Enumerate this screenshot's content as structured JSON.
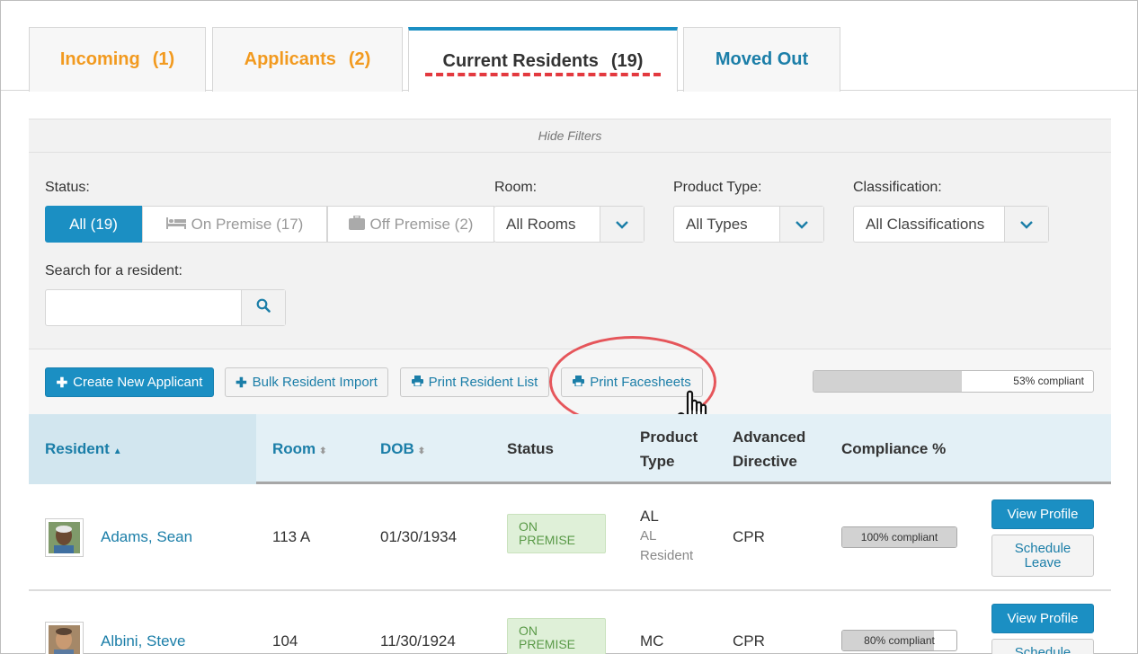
{
  "tabs": [
    {
      "label": "Incoming",
      "count": "(1)",
      "color": "#f29a1f"
    },
    {
      "label": "Applicants",
      "count": "(2)",
      "color": "#f29a1f"
    },
    {
      "label": "Current Residents",
      "count": "(19)",
      "active": true
    },
    {
      "label": "Moved Out",
      "count": "",
      "color": "#1b7ea8"
    }
  ],
  "filters": {
    "hide_label": "Hide Filters",
    "status_label": "Status:",
    "status_options": [
      {
        "label": "All (19)",
        "selected": true,
        "icon": ""
      },
      {
        "label": "On Premise (17)",
        "selected": false,
        "icon": "bed-icon"
      },
      {
        "label": "Off Premise (2)",
        "selected": false,
        "icon": "suitcase-icon"
      }
    ],
    "room_label": "Room:",
    "room_value": "All Rooms",
    "product_type_label": "Product Type:",
    "product_type_value": "All Types",
    "classification_label": "Classification:",
    "classification_value": "All Classifications",
    "search_label": "Search for a resident:",
    "search_value": "",
    "search_placeholder": ""
  },
  "actions": {
    "create": "Create New Applicant",
    "bulk_import": "Bulk Resident Import",
    "print_list": "Print Resident List",
    "print_facesheets": "Print Facesheets",
    "compliance_text": "53% compliant",
    "compliance_value": 0.53
  },
  "table": {
    "headers": {
      "resident": "Resident",
      "room": "Room",
      "dob": "DOB",
      "status": "Status",
      "product_type_1": "Product",
      "product_type_2": "Type",
      "directive_1": "Advanced",
      "directive_2": "Directive",
      "compliance": "Compliance %"
    },
    "rows": [
      {
        "name": "Adams, Sean",
        "room": "113 A",
        "dob": "01/30/1934",
        "status_1": "ON",
        "status_2": "PREMISE",
        "product": "AL",
        "product_sub_1": "AL",
        "product_sub_2": "Resident",
        "directive": "CPR",
        "compliance_text": "100% compliant",
        "compliance_value": 1.0,
        "view_profile": "View Profile",
        "schedule_1": "Schedule",
        "schedule_2": "Leave"
      },
      {
        "name": "Albini, Steve",
        "room": "104",
        "dob": "11/30/1924",
        "status_1": "ON",
        "status_2": "PREMISE",
        "product": "MC",
        "directive": "CPR",
        "compliance_text": "80% compliant",
        "compliance_value": 0.8,
        "view_profile": "View Profile",
        "schedule_1": "Schedule"
      }
    ]
  },
  "colors": {
    "accent": "#1b8fc3",
    "orange": "#f29a1f",
    "annotation_red": "#e3393f",
    "on_premise_green": "#dff0d8"
  }
}
